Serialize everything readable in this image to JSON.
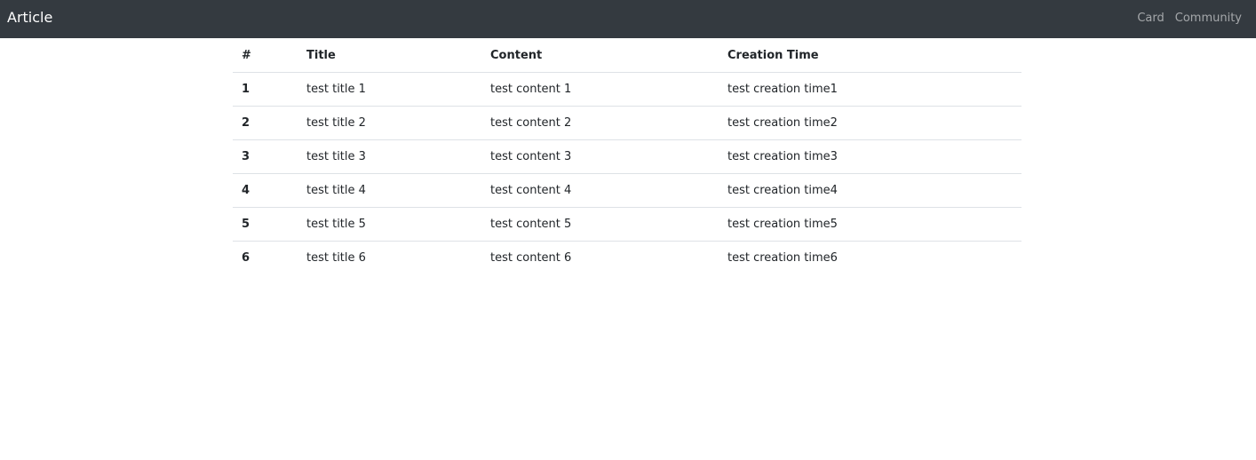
{
  "navbar": {
    "brand": "Article",
    "links": [
      "Card",
      "Community"
    ]
  },
  "table": {
    "headers": [
      "#",
      "Title",
      "Content",
      "Creation Time"
    ],
    "rows": [
      [
        "1",
        "test title 1",
        "test content 1",
        "test creation time1"
      ],
      [
        "2",
        "test title 2",
        "test content 2",
        "test creation time2"
      ],
      [
        "3",
        "test title 3",
        "test content 3",
        "test creation time3"
      ],
      [
        "4",
        "test title 4",
        "test content 4",
        "test creation time4"
      ],
      [
        "5",
        "test title 5",
        "test content 5",
        "test creation time5"
      ],
      [
        "6",
        "test title 6",
        "test content 6",
        "test creation time6"
      ]
    ]
  },
  "colors": {
    "navbar_bg": "#343a40",
    "border": "#dee2e6"
  }
}
